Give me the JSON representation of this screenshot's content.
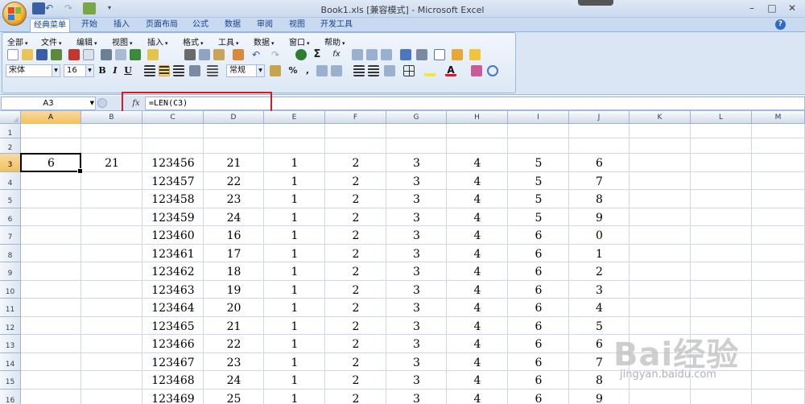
{
  "window": {
    "title": "Book1.xls  [兼容模式] - Microsoft Excel",
    "min": "–",
    "max": "□",
    "close": "✕"
  },
  "ribbon_tabs": [
    "经典菜单",
    "开始",
    "插入",
    "页面布局",
    "公式",
    "数据",
    "审阅",
    "视图",
    "开发工具"
  ],
  "help_label": "?",
  "classic_menu": [
    "全部",
    "文件",
    "编辑",
    "视图",
    "插入",
    "格式",
    "工具",
    "数据",
    "窗口",
    "帮助"
  ],
  "font": {
    "name": "宋体",
    "size": "16"
  },
  "format_buttons": {
    "bold": "B",
    "italic": "I",
    "underline": "U"
  },
  "number_format": "常规",
  "formula_bar": {
    "name_box": "A3",
    "fx": "fx",
    "formula": "=LEN(C3)"
  },
  "columns": [
    "A",
    "B",
    "C",
    "D",
    "E",
    "F",
    "G",
    "H",
    "I",
    "J",
    "K",
    "L",
    "M"
  ],
  "rows": [
    {
      "num": "1",
      "cells": [
        "",
        "",
        "",
        "",
        "",
        "",
        "",
        "",
        "",
        ""
      ]
    },
    {
      "num": "2",
      "cells": [
        "",
        "",
        "",
        "",
        "",
        "",
        "",
        "",
        "",
        ""
      ]
    },
    {
      "num": "3",
      "cells": [
        "6",
        "21",
        "123456",
        "21",
        "1",
        "2",
        "3",
        "4",
        "5",
        "6"
      ]
    },
    {
      "num": "4",
      "cells": [
        "",
        "",
        "123457",
        "22",
        "1",
        "2",
        "3",
        "4",
        "5",
        "7"
      ]
    },
    {
      "num": "5",
      "cells": [
        "",
        "",
        "123458",
        "23",
        "1",
        "2",
        "3",
        "4",
        "5",
        "8"
      ]
    },
    {
      "num": "6",
      "cells": [
        "",
        "",
        "123459",
        "24",
        "1",
        "2",
        "3",
        "4",
        "5",
        "9"
      ]
    },
    {
      "num": "7",
      "cells": [
        "",
        "",
        "123460",
        "16",
        "1",
        "2",
        "3",
        "4",
        "6",
        "0"
      ]
    },
    {
      "num": "8",
      "cells": [
        "",
        "",
        "123461",
        "17",
        "1",
        "2",
        "3",
        "4",
        "6",
        "1"
      ]
    },
    {
      "num": "9",
      "cells": [
        "",
        "",
        "123462",
        "18",
        "1",
        "2",
        "3",
        "4",
        "6",
        "2"
      ]
    },
    {
      "num": "10",
      "cells": [
        "",
        "",
        "123463",
        "19",
        "1",
        "2",
        "3",
        "4",
        "6",
        "3"
      ]
    },
    {
      "num": "11",
      "cells": [
        "",
        "",
        "123464",
        "20",
        "1",
        "2",
        "3",
        "4",
        "6",
        "4"
      ]
    },
    {
      "num": "12",
      "cells": [
        "",
        "",
        "123465",
        "21",
        "1",
        "2",
        "3",
        "4",
        "6",
        "5"
      ]
    },
    {
      "num": "13",
      "cells": [
        "",
        "",
        "123466",
        "22",
        "1",
        "2",
        "3",
        "4",
        "6",
        "6"
      ]
    },
    {
      "num": "14",
      "cells": [
        "",
        "",
        "123467",
        "23",
        "1",
        "2",
        "3",
        "4",
        "6",
        "7"
      ]
    },
    {
      "num": "15",
      "cells": [
        "",
        "",
        "123468",
        "24",
        "1",
        "2",
        "3",
        "4",
        "6",
        "8"
      ]
    },
    {
      "num": "16",
      "cells": [
        "",
        "",
        "123469",
        "25",
        "1",
        "2",
        "3",
        "4",
        "6",
        "9"
      ]
    }
  ],
  "selected": {
    "col": "A",
    "row": "3"
  },
  "watermark": {
    "brand": "Bai经验",
    "url": "jingyan.baidu.com"
  },
  "colors": {
    "highlight": "#d9181f",
    "selected_header": "#f1c15f"
  }
}
